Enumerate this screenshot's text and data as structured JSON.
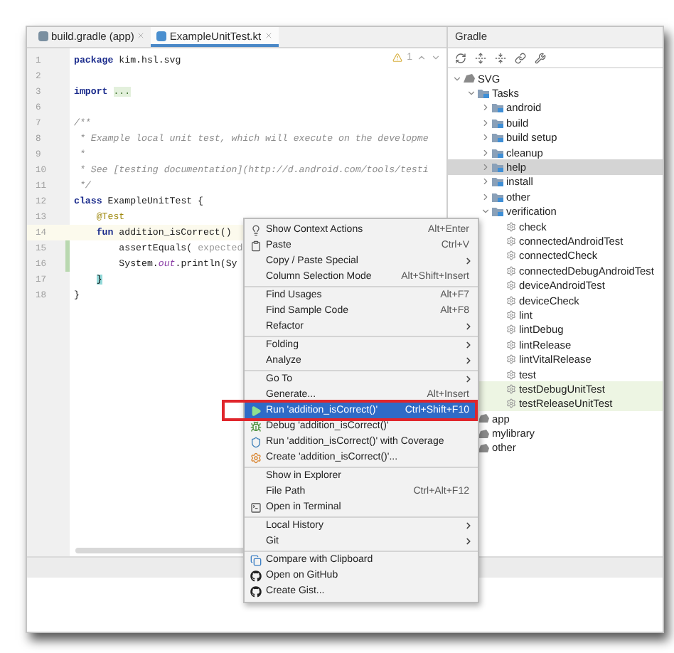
{
  "editor": {
    "tabs": [
      {
        "label": "build.gradle (app)",
        "kind": "gradle",
        "selected": false
      },
      {
        "label": "ExampleUnitTest.kt",
        "kind": "kotlin",
        "selected": true
      }
    ],
    "inspection": {
      "warnings": "1"
    },
    "lines": [
      {
        "number": "1",
        "current": false,
        "changed": false,
        "segments": [
          {
            "kind": "keyword",
            "text": "package "
          },
          {
            "kind": "plain",
            "text": "kim.hsl.svg"
          }
        ]
      },
      {
        "number": "2",
        "current": false,
        "changed": false
      },
      {
        "number": "3",
        "current": false,
        "changed": false,
        "segments": [
          {
            "kind": "keyword",
            "text": "import "
          },
          {
            "kind": "folded",
            "text": "..."
          }
        ]
      },
      {
        "number": "6",
        "current": false,
        "changed": false
      },
      {
        "number": "7",
        "current": false,
        "changed": false,
        "segments": [
          {
            "kind": "comment",
            "text": "/**"
          }
        ]
      },
      {
        "number": "8",
        "current": false,
        "changed": false,
        "segments": [
          {
            "kind": "comment",
            "text": " * Example local unit test, which will execute on the developme"
          }
        ]
      },
      {
        "number": "9",
        "current": false,
        "changed": false,
        "segments": [
          {
            "kind": "comment",
            "text": " *"
          }
        ]
      },
      {
        "number": "10",
        "current": false,
        "changed": false,
        "segments": [
          {
            "kind": "comment",
            "text": " * See [testing documentation](http://d.android.com/tools/testi"
          }
        ]
      },
      {
        "number": "11",
        "current": false,
        "changed": false,
        "segments": [
          {
            "kind": "comment",
            "text": " */"
          }
        ]
      },
      {
        "number": "12",
        "current": false,
        "changed": false,
        "segments": [
          {
            "kind": "keyword",
            "text": "class "
          },
          {
            "kind": "plain",
            "text": "ExampleUnitTest {"
          }
        ]
      },
      {
        "number": "13",
        "current": false,
        "changed": false,
        "segments": [
          {
            "kind": "annotation",
            "text": "    @Test"
          }
        ]
      },
      {
        "number": "14",
        "current": true,
        "changed": false,
        "segments": [
          {
            "kind": "keyword",
            "text": "    fun "
          },
          {
            "kind": "plain",
            "text": "addition_isCorrect()"
          }
        ]
      },
      {
        "number": "15",
        "current": false,
        "changed": true,
        "segments": [
          {
            "kind": "plain",
            "text": "        assertEquals( "
          },
          {
            "kind": "hint",
            "text": "expected"
          }
        ]
      },
      {
        "number": "16",
        "current": false,
        "changed": true,
        "segments": [
          {
            "kind": "plain",
            "text": "        System."
          },
          {
            "kind": "static",
            "text": "out"
          },
          {
            "kind": "plain",
            "text": ".println(Sy"
          }
        ]
      },
      {
        "number": "17",
        "current": false,
        "changed": false,
        "segments": [
          {
            "kind": "brace_match",
            "text": "    }"
          }
        ]
      },
      {
        "number": "18",
        "current": false,
        "changed": false,
        "segments": [
          {
            "kind": "plain",
            "text": "}"
          }
        ]
      }
    ]
  },
  "gradle": {
    "title": "Gradle",
    "tree": [
      {
        "label": "SVG",
        "kind": "project",
        "expanded": true,
        "selected": false,
        "highlighted": false,
        "children": [
          {
            "label": "Tasks",
            "kind": "folder",
            "expanded": true,
            "selected": false,
            "highlighted": false,
            "children": [
              {
                "label": "android",
                "kind": "folder",
                "expanded": false,
                "selected": false,
                "highlighted": false
              },
              {
                "label": "build",
                "kind": "folder",
                "expanded": false,
                "selected": false,
                "highlighted": false
              },
              {
                "label": "build setup",
                "kind": "folder",
                "expanded": false,
                "selected": false,
                "highlighted": false
              },
              {
                "label": "cleanup",
                "kind": "folder",
                "expanded": false,
                "selected": false,
                "highlighted": false
              },
              {
                "label": "help",
                "kind": "folder",
                "expanded": false,
                "selected": true,
                "highlighted": false
              },
              {
                "label": "install",
                "kind": "folder",
                "expanded": false,
                "selected": false,
                "highlighted": false
              },
              {
                "label": "other",
                "kind": "folder",
                "expanded": false,
                "selected": false,
                "highlighted": false
              },
              {
                "label": "verification",
                "kind": "folder",
                "expanded": true,
                "selected": false,
                "highlighted": false,
                "children": [
                  {
                    "label": "check",
                    "kind": "task",
                    "selected": false,
                    "highlighted": false
                  },
                  {
                    "label": "connectedAndroidTest",
                    "kind": "task",
                    "selected": false,
                    "highlighted": false
                  },
                  {
                    "label": "connectedCheck",
                    "kind": "task",
                    "selected": false,
                    "highlighted": false
                  },
                  {
                    "label": "connectedDebugAndroidTest",
                    "kind": "task",
                    "selected": false,
                    "highlighted": false
                  },
                  {
                    "label": "deviceAndroidTest",
                    "kind": "task",
                    "selected": false,
                    "highlighted": false
                  },
                  {
                    "label": "deviceCheck",
                    "kind": "task",
                    "selected": false,
                    "highlighted": false
                  },
                  {
                    "label": "lint",
                    "kind": "task",
                    "selected": false,
                    "highlighted": false
                  },
                  {
                    "label": "lintDebug",
                    "kind": "task",
                    "selected": false,
                    "highlighted": false
                  },
                  {
                    "label": "lintRelease",
                    "kind": "task",
                    "selected": false,
                    "highlighted": false
                  },
                  {
                    "label": "lintVitalRelease",
                    "kind": "task",
                    "selected": false,
                    "highlighted": false
                  },
                  {
                    "label": "test",
                    "kind": "task",
                    "selected": false,
                    "highlighted": false
                  },
                  {
                    "label": "testDebugUnitTest",
                    "kind": "task",
                    "selected": false,
                    "highlighted": true
                  },
                  {
                    "label": "testReleaseUnitTest",
                    "kind": "task",
                    "selected": false,
                    "highlighted": true
                  }
                ]
              }
            ]
          },
          {
            "label": "app",
            "kind": "project",
            "selected": false,
            "highlighted": false
          },
          {
            "label": "mylibrary",
            "kind": "project",
            "selected": false,
            "highlighted": false
          },
          {
            "label": "other",
            "kind": "project",
            "selected": false,
            "highlighted": false
          }
        ]
      }
    ]
  },
  "context_menu": {
    "items": [
      {
        "label": "Show Context Actions",
        "shortcut": "Alt+Enter",
        "kind": "bulb",
        "submenu": false,
        "separator_before": false,
        "selected": false
      },
      {
        "label": "Paste",
        "shortcut": "Ctrl+V",
        "kind": "clipboard",
        "submenu": false,
        "separator_before": false,
        "selected": false
      },
      {
        "label": "Copy / Paste Special",
        "kind": "plain",
        "submenu": true,
        "separator_before": false,
        "selected": false
      },
      {
        "label": "Column Selection Mode",
        "shortcut": "Alt+Shift+Insert",
        "kind": "plain",
        "submenu": false,
        "separator_before": false,
        "selected": false
      },
      {
        "label": "Find Usages",
        "shortcut": "Alt+F7",
        "kind": "plain",
        "submenu": false,
        "separator_before": true,
        "selected": false
      },
      {
        "label": "Find Sample Code",
        "shortcut": "Alt+F8",
        "kind": "plain",
        "submenu": false,
        "separator_before": false,
        "selected": false
      },
      {
        "label": "Refactor",
        "kind": "plain",
        "submenu": true,
        "separator_before": false,
        "selected": false
      },
      {
        "label": "Folding",
        "kind": "plain",
        "submenu": true,
        "separator_before": true,
        "selected": false
      },
      {
        "label": "Analyze",
        "kind": "plain",
        "submenu": true,
        "separator_before": false,
        "selected": false
      },
      {
        "label": "Go To",
        "kind": "plain",
        "submenu": true,
        "separator_before": true,
        "selected": false
      },
      {
        "label": "Generate...",
        "shortcut": "Alt+Insert",
        "kind": "plain",
        "submenu": false,
        "separator_before": false,
        "selected": false
      },
      {
        "label": "Run 'addition_isCorrect()'",
        "shortcut": "Ctrl+Shift+F10",
        "kind": "run",
        "submenu": false,
        "separator_before": false,
        "selected": true
      },
      {
        "label": "Debug 'addition_isCorrect()'",
        "kind": "debug",
        "submenu": false,
        "separator_before": false,
        "selected": false
      },
      {
        "label": "Run 'addition_isCorrect()' with Coverage",
        "kind": "coverage",
        "submenu": false,
        "separator_before": false,
        "selected": false
      },
      {
        "label": "Create 'addition_isCorrect()'...",
        "kind": "config",
        "submenu": false,
        "separator_before": false,
        "selected": false
      },
      {
        "label": "Show in Explorer",
        "kind": "plain",
        "submenu": false,
        "separator_before": true,
        "selected": false
      },
      {
        "label": "File Path",
        "shortcut": "Ctrl+Alt+F12",
        "kind": "plain",
        "submenu": false,
        "separator_before": false,
        "selected": false
      },
      {
        "label": "Open in Terminal",
        "kind": "terminal",
        "submenu": false,
        "separator_before": false,
        "selected": false
      },
      {
        "label": "Local History",
        "kind": "plain",
        "submenu": true,
        "separator_before": true,
        "selected": false
      },
      {
        "label": "Git",
        "kind": "plain",
        "submenu": true,
        "separator_before": false,
        "selected": false
      },
      {
        "label": "Compare with Clipboard",
        "kind": "compare",
        "submenu": false,
        "separator_before": true,
        "selected": false
      },
      {
        "label": "Open on GitHub",
        "kind": "github",
        "submenu": false,
        "separator_before": false,
        "selected": false
      },
      {
        "label": "Create Gist...",
        "kind": "github",
        "submenu": false,
        "separator_before": false,
        "selected": false
      }
    ]
  }
}
